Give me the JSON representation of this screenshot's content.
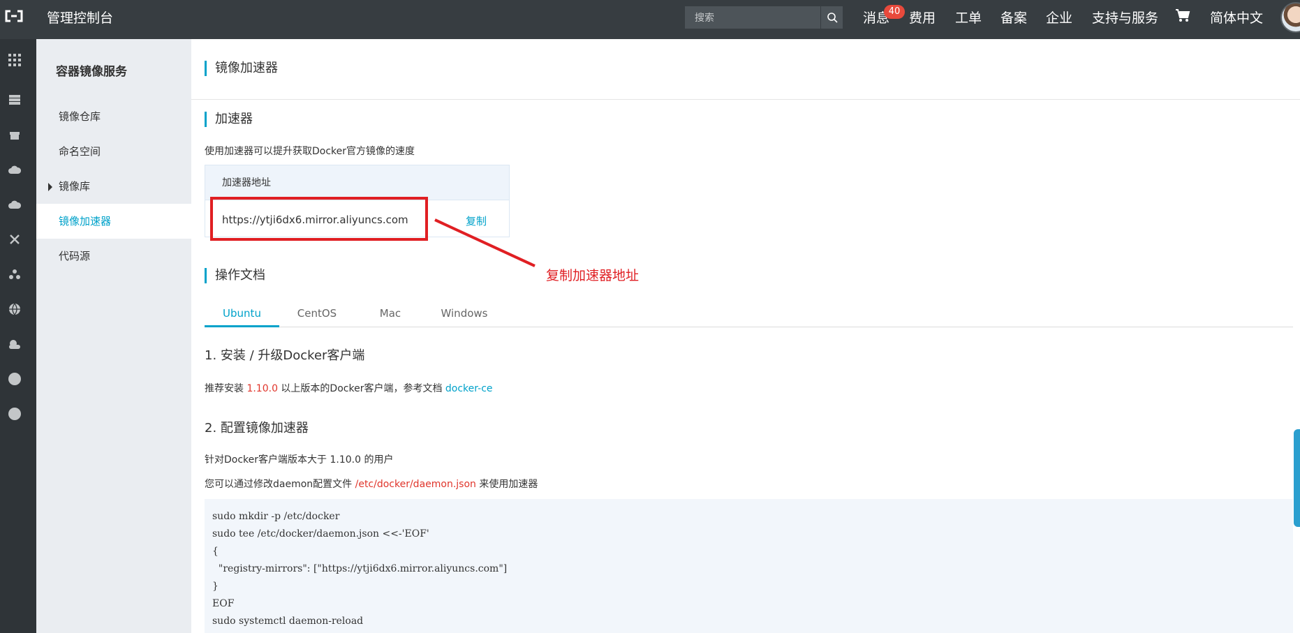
{
  "header": {
    "title": "管理控制台",
    "search_placeholder": "搜索",
    "nav": {
      "messages": "消息",
      "message_count": "40",
      "billing": "费用",
      "tickets": "工单",
      "icp": "备案",
      "enterprise": "企业",
      "support": "支持与服务",
      "language": "简体中文"
    }
  },
  "rail_icons": [
    "grid-icon",
    "server-icon",
    "gift-icon",
    "cloud-icon",
    "cloud-upload-icon",
    "cross-icon",
    "cluster-icon",
    "globe-icon",
    "gear-cloud-icon",
    "dot-icon",
    "dot-icon"
  ],
  "sidebar": {
    "title": "容器镜像服务",
    "items": [
      {
        "label": "镜像仓库"
      },
      {
        "label": "命名空间"
      },
      {
        "label": "镜像库"
      },
      {
        "label": "镜像加速器"
      },
      {
        "label": "代码源"
      }
    ]
  },
  "main": {
    "page_title": "镜像加速器",
    "accelerator": {
      "section_title": "加速器",
      "description": "使用加速器可以提升获取Docker官方镜像的速度",
      "table_header": "加速器地址",
      "url": "https://ytji6dx6.mirror.aliyuncs.com",
      "copy_label": "复制",
      "annotation": "复制加速器地址"
    },
    "docs": {
      "section_title": "操作文档",
      "tabs": [
        "Ubuntu",
        "CentOS",
        "Mac",
        "Windows"
      ],
      "step1_title": "1. 安装 / 升级Docker客户端",
      "step1_prefix": "推荐安装 ",
      "step1_version": "1.10.0",
      "step1_middle": " 以上版本的Docker客户端，参考文档 ",
      "step1_link": "docker-ce",
      "step2_title": "2. 配置镜像加速器",
      "step2_line1": "针对Docker客户端版本大于 1.10.0 的用户",
      "step2_line2_prefix": "您可以通过修改daemon配置文件 ",
      "step2_line2_path": "/etc/docker/daemon.json",
      "step2_line2_suffix": " 来使用加速器",
      "code_lines": [
        "sudo mkdir -p /etc/docker",
        "sudo tee /etc/docker/daemon.json <<-'EOF'",
        "{",
        "  \"registry-mirrors\": [\"https://ytji6dx6.mirror.aliyuncs.com\"]",
        "}",
        "EOF",
        "sudo systemctl daemon-reload"
      ]
    }
  },
  "colors": {
    "topbar": "#373d41",
    "accent": "#00a2ca",
    "annotation_red": "#e01f23"
  }
}
